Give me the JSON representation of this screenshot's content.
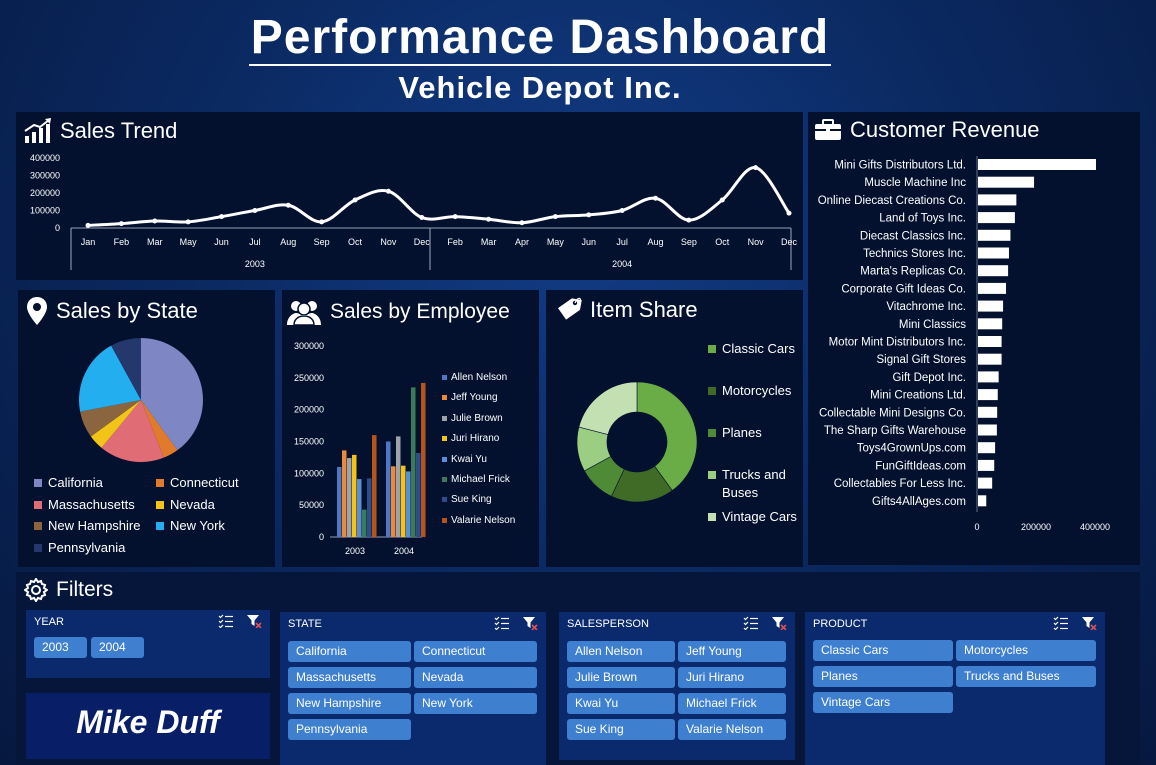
{
  "header": {
    "title": "Performance Dashboard",
    "subtitle": "Vehicle Depot Inc."
  },
  "colors": {
    "page_bg": "#0b2a63",
    "panel_bg": "#03112e",
    "slicer_bg": "#0b2a6e",
    "chip_bg": "#3e7fd0",
    "line": "#ffffff"
  },
  "sales_trend": {
    "title": "Sales Trend",
    "icon": "chart-growth-icon",
    "chart_data": {
      "type": "line",
      "y_ticks": [
        "400000",
        "300000",
        "200000",
        "100000",
        "0"
      ],
      "ylim": [
        0,
        400000
      ],
      "x_groups": [
        {
          "label": "2003",
          "months": [
            "Jan",
            "Feb",
            "Mar",
            "May",
            "Jun",
            "Jul",
            "Aug",
            "Sep",
            "Oct",
            "Nov",
            "Dec"
          ]
        },
        {
          "label": "2004",
          "months": [
            "Feb",
            "Mar",
            "Apr",
            "May",
            "Jun",
            "Jul",
            "Aug",
            "Sep",
            "Oct",
            "Nov",
            "Dec"
          ]
        }
      ],
      "values": [
        15000,
        25000,
        40000,
        35000,
        65000,
        100000,
        130000,
        35000,
        160000,
        210000,
        60000,
        65000,
        50000,
        30000,
        65000,
        75000,
        100000,
        170000,
        45000,
        160000,
        345000,
        85000
      ]
    }
  },
  "customer_revenue": {
    "title": "Customer Revenue",
    "icon": "briefcase-icon",
    "chart_data": {
      "type": "bar",
      "orientation": "horizontal",
      "categories": [
        "Mini Gifts Distributors Ltd.",
        "Muscle Machine Inc",
        "Online Diecast Creations Co.",
        "Land of Toys Inc.",
        "Diecast Classics Inc.",
        "Technics Stores Inc.",
        "Marta's Replicas Co.",
        "Corporate Gift Ideas Co.",
        "Vitachrome Inc.",
        "Mini Classics",
        "Motor Mint Distributors Inc.",
        "Signal Gift Stores",
        "Gift Depot Inc.",
        "Mini Creations Ltd.",
        "Collectable Mini Designs Co.",
        "The Sharp Gifts Warehouse",
        "Toys4GrownUps.com",
        "FunGiftIdeas.com",
        "Collectables For Less Inc.",
        "Gifts4AllAges.com"
      ],
      "values": [
        400000,
        190000,
        130000,
        125000,
        110000,
        105000,
        102000,
        95000,
        85000,
        82000,
        80000,
        80000,
        70000,
        67000,
        65000,
        64000,
        58000,
        55000,
        48000,
        28000
      ],
      "x_ticks": [
        "0",
        "200000",
        "400000"
      ],
      "xlim": [
        0,
        400000
      ]
    }
  },
  "sales_by_state": {
    "title": "Sales by State",
    "icon": "map-pin-icon",
    "chart_data": {
      "type": "pie",
      "labels": [
        "California",
        "Connecticut",
        "Massachusetts",
        "Nevada",
        "New Hampshire",
        "New York",
        "Pennsylvania"
      ],
      "values": [
        40,
        4,
        17,
        4,
        7,
        20,
        8
      ],
      "colors": [
        "#7f86c4",
        "#e07b2c",
        "#e06c75",
        "#f2c418",
        "#8b6440",
        "#23aef0",
        "#24386e"
      ]
    }
  },
  "sales_by_employee": {
    "title": "Sales by Employee",
    "icon": "users-icon",
    "chart_data": {
      "type": "bar",
      "categories": [
        "2003",
        "2004"
      ],
      "y_ticks": [
        "300000",
        "250000",
        "200000",
        "150000",
        "100000",
        "50000",
        "0"
      ],
      "ylim": [
        0,
        300000
      ],
      "series": [
        {
          "name": "Allen Nelson",
          "color": "#4f78c4",
          "values": [
            110000,
            150000
          ]
        },
        {
          "name": "Jeff Young",
          "color": "#e98a3c",
          "values": [
            136000,
            111000
          ]
        },
        {
          "name": "Julie Brown",
          "color": "#9ea3aa",
          "values": [
            124000,
            158000
          ]
        },
        {
          "name": "Juri Hirano",
          "color": "#f3c21b",
          "values": [
            129000,
            112000
          ]
        },
        {
          "name": "Kwai Yu",
          "color": "#5a8fd6",
          "values": [
            91000,
            103000
          ]
        },
        {
          "name": "Michael Frick",
          "color": "#3a7c5a",
          "values": [
            43000,
            235000
          ]
        },
        {
          "name": "Sue King",
          "color": "#2a4f8a",
          "values": [
            92000,
            132000
          ]
        },
        {
          "name": "Valarie Nelson",
          "color": "#b8531c",
          "values": [
            160000,
            242000
          ]
        }
      ]
    }
  },
  "item_share": {
    "title": "Item Share",
    "icon": "price-tag-icon",
    "chart_data": {
      "type": "pie",
      "donut": true,
      "labels": [
        "Classic Cars",
        "Motorcycles",
        "Planes",
        "Trucks and Buses",
        "Vintage Cars"
      ],
      "values": [
        40,
        17,
        10,
        12,
        21
      ],
      "colors": [
        "#6aac45",
        "#3f6b26",
        "#4f8a37",
        "#9bcd82",
        "#c3e0b3"
      ]
    }
  },
  "filters": {
    "title": "Filters",
    "icon": "gear-icon",
    "year": {
      "label": "YEAR",
      "options": [
        "2003",
        "2004"
      ]
    },
    "state": {
      "label": "STATE",
      "options": [
        "California",
        "Connecticut",
        "Massachusetts",
        "Nevada",
        "New Hampshire",
        "New York",
        "Pennsylvania"
      ]
    },
    "salesperson": {
      "label": "SALESPERSON",
      "options": [
        "Allen Nelson",
        "Jeff Young",
        "Julie Brown",
        "Juri Hirano",
        "Kwai Yu",
        "Michael Frick",
        "Sue King",
        "Valarie Nelson"
      ]
    },
    "product": {
      "label": "PRODUCT",
      "options": [
        "Classic Cars",
        "Motorcycles",
        "Planes",
        "Trucks and Buses",
        "Vintage Cars"
      ]
    }
  },
  "signature": "Mike Duff"
}
